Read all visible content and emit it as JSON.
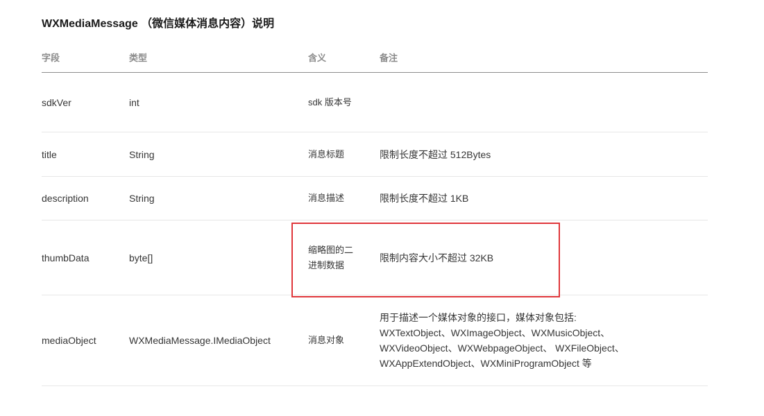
{
  "title": "WXMediaMessage （微信媒体消息内容）说明",
  "headers": {
    "field": "字段",
    "type": "类型",
    "meaning": "含义",
    "remark": "备注"
  },
  "rows": [
    {
      "field": "sdkVer",
      "type": "int",
      "meaning": "sdk 版本号",
      "remark": []
    },
    {
      "field": "title",
      "type": "String",
      "meaning": "消息标题",
      "remark": [
        "限制长度不超过 512Bytes"
      ]
    },
    {
      "field": "description",
      "type": "String",
      "meaning": "消息描述",
      "remark": [
        "限制长度不超过 1KB"
      ]
    },
    {
      "field": "thumbData",
      "type": "byte[]",
      "meaning": "缩略图的二进制数据",
      "remark": [
        "限制内容大小不超过 32KB"
      ]
    },
    {
      "field": "mediaObject",
      "type": "WXMediaMessage.IMediaObject",
      "meaning": "消息对象",
      "remark": [
        "用于描述一个媒体对象的接口，媒体对象包括:",
        "WXTextObject、WXImageObject、WXMusicObject、",
        "WXVideoObject、WXWebpageObject、 WXFileObject、",
        "WXAppExtendObject、WXMiniProgramObject 等"
      ]
    }
  ],
  "highlight_color": "#e0363a"
}
